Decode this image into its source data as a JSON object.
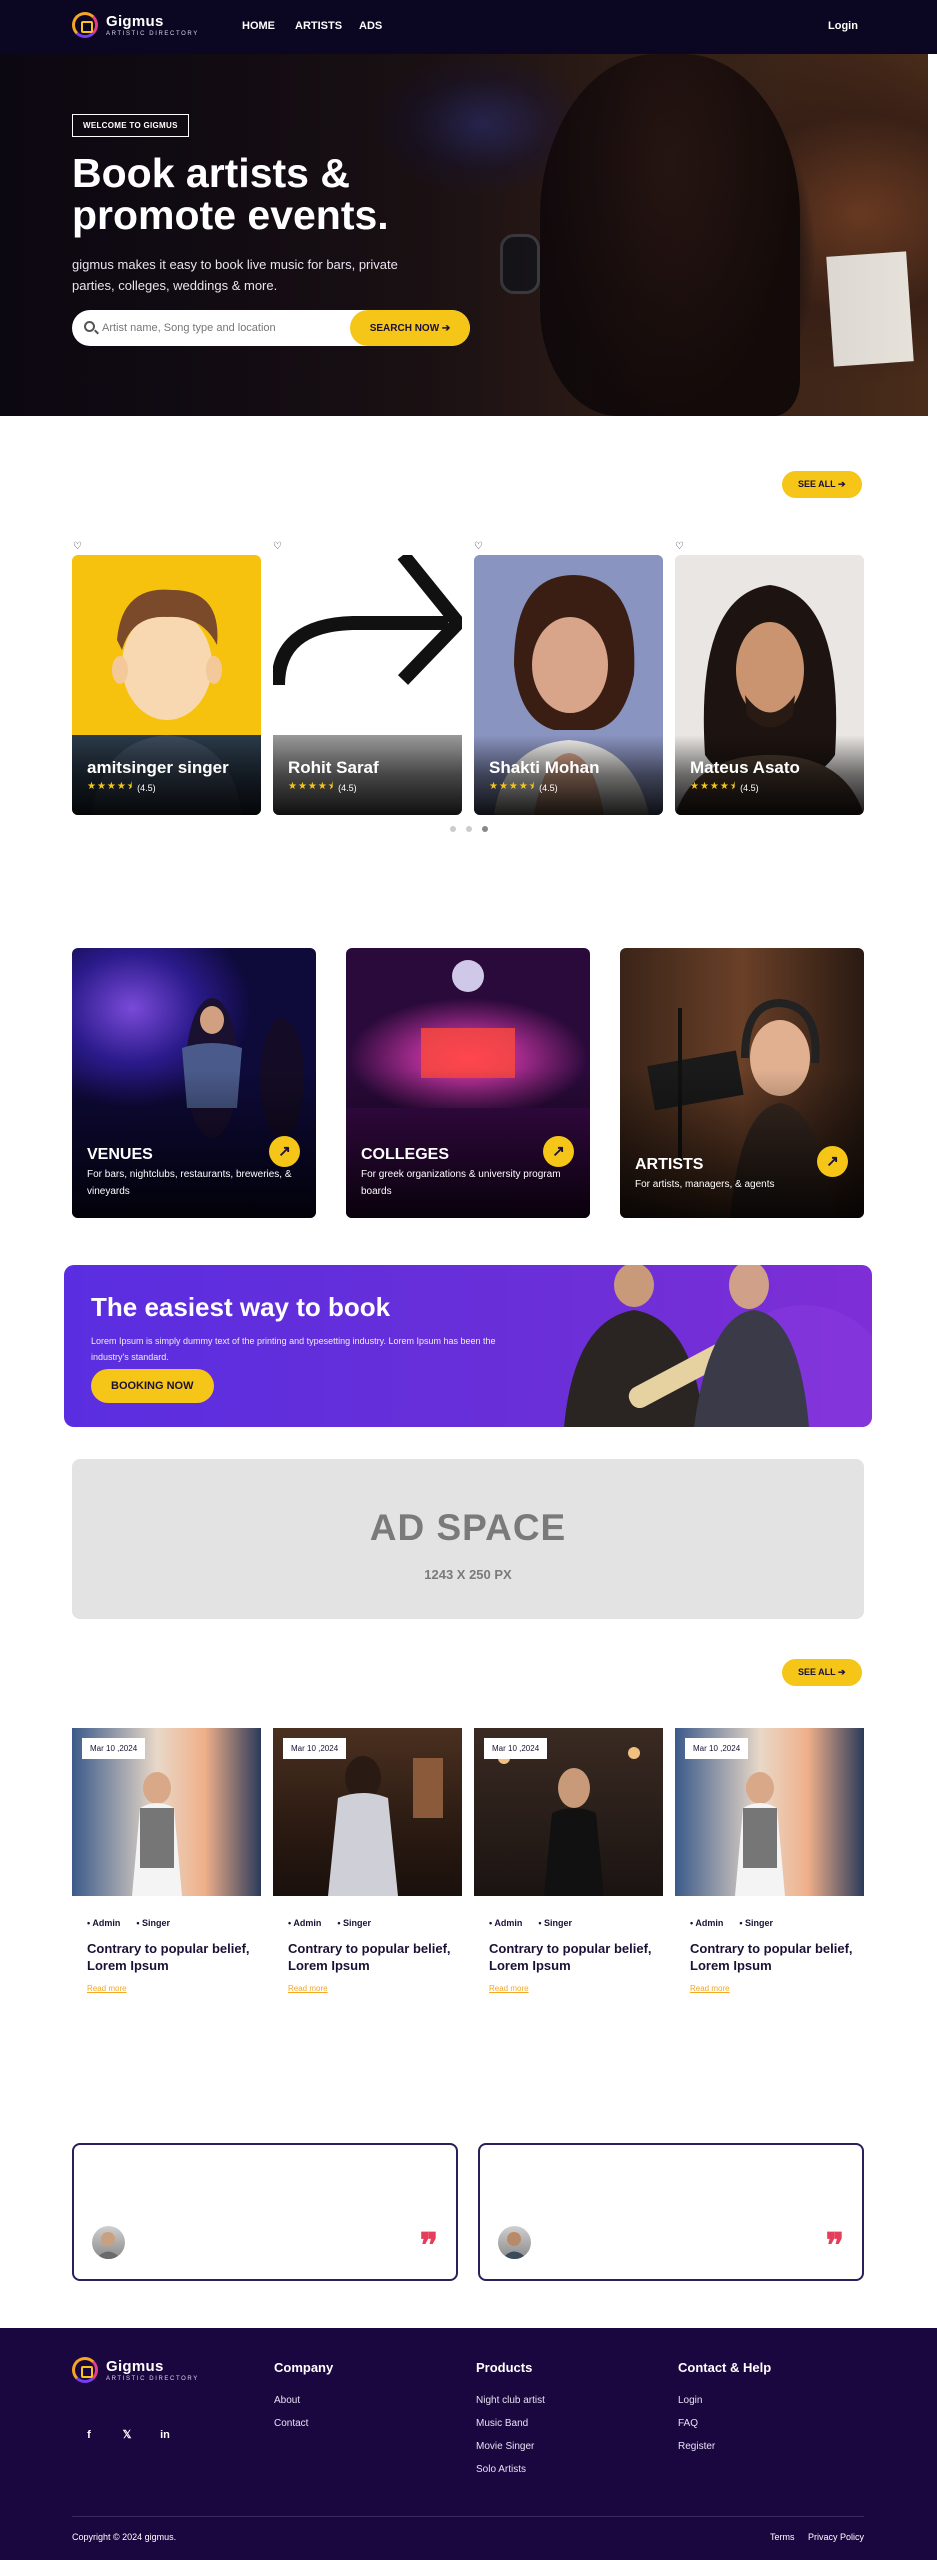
{
  "brand": {
    "name": "Gigmus",
    "tagline": "ARTISTIC DIRECTORY"
  },
  "nav": {
    "items": [
      "HOME",
      "ARTISTS",
      "ADS"
    ],
    "login": "Login"
  },
  "hero": {
    "badge": "WELCOME TO GIGMUS",
    "title": "Book artists & promote events.",
    "subtitle": "gigmus makes it easy to book live music for bars, private parties, colleges, weddings & more.",
    "search_placeholder": "Artist name, Song type and location",
    "search_button": "SEARCH NOW ➔"
  },
  "artists": {
    "see_all": "SEE ALL ➔",
    "cards": [
      {
        "name": "amitsinger singer",
        "rating": "(4.5)",
        "stars": "★★★★⯨"
      },
      {
        "name": "Rohit Saraf",
        "rating": "(4.5)",
        "stars": "★★★★⯨"
      },
      {
        "name": "Shakti Mohan",
        "rating": "(4.5)",
        "stars": "★★★★⯨"
      },
      {
        "name": "Mateus Asato",
        "rating": "(4.5)",
        "stars": "★★★★⯨"
      }
    ]
  },
  "categories": [
    {
      "title": "VENUES",
      "desc": "For bars, nightclubs, restaurants, breweries, & vineyards"
    },
    {
      "title": "COLLEGES",
      "desc": "For greek organizations & university program boards"
    },
    {
      "title": "ARTISTS",
      "desc": "For artists, managers, & agents"
    }
  ],
  "promo": {
    "title": "The easiest way to book",
    "text": "Lorem Ipsum is simply dummy text of the printing and typesetting industry. Lorem Ipsum has been the industry's standard.",
    "button": "BOOKING NOW"
  },
  "ad": {
    "title": "AD SPACE",
    "size": "1243  X 250 PX"
  },
  "blog": {
    "see_all": "SEE ALL ➔",
    "posts": [
      {
        "date": "Mar 10 ,2024",
        "author": "• Admin",
        "tag": "• Singer",
        "title": "Contrary to popular belief, Lorem Ipsum",
        "more": "Read more"
      },
      {
        "date": "Mar 10 ,2024",
        "author": "• Admin",
        "tag": "• Singer",
        "title": "Contrary to popular belief, Lorem Ipsum",
        "more": "Read more"
      },
      {
        "date": "Mar 10 ,2024",
        "author": "• Admin",
        "tag": "• Singer",
        "title": "Contrary to popular belief, Lorem Ipsum",
        "more": "Read more"
      },
      {
        "date": "Mar 10 ,2024",
        "author": "• Admin",
        "tag": "• Singer",
        "title": "Contrary to popular belief, Lorem Ipsum",
        "more": "Read more"
      }
    ]
  },
  "testimonials": {
    "quote_mark": "❞"
  },
  "footer": {
    "social": [
      "f",
      "𝕏",
      "in"
    ],
    "company": {
      "title": "Company",
      "links": [
        "About",
        "Contact"
      ]
    },
    "products": {
      "title": "Products",
      "links": [
        "Night club artist",
        "Music Band",
        "Movie Singer",
        "Solo Artists"
      ]
    },
    "contact": {
      "title": "Contact & Help",
      "links": [
        "Login",
        "FAQ",
        "Register"
      ]
    },
    "copyright": "Copyright © 2024 gigmus.",
    "terms": "Terms",
    "privacy": "Privacy Policy"
  },
  "colors": {
    "accent": "#f5c518",
    "dark": "#0b0722",
    "footer": "#1b0740",
    "promo": "#6a2fd8",
    "quote": "#e63d5a"
  }
}
